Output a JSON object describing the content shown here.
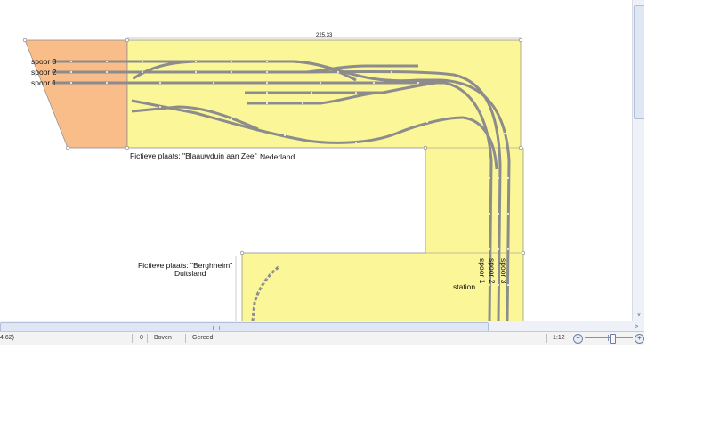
{
  "layout": {
    "upper_section": {
      "town_label": "Fictieve plaats: \"Blaauwduin aan Zee\"",
      "country": "Nederland",
      "tracks": [
        "spoor 3",
        "spoor 2",
        "spoor 1"
      ],
      "dimension": "225,33"
    },
    "lower_section": {
      "town_label_line1": "Fictieve plaats: \"Berghheim\"",
      "town_label_line2": "Duitsland",
      "station_label": "station",
      "station_tracks": [
        "spoor 1",
        "spoor 2",
        "spoor 3"
      ]
    },
    "colors": {
      "baseboard": "#fbf697",
      "baseboard_outline": "#8a8a8a",
      "corner_piece": "#f9bd8a",
      "track": "#8c8c8c"
    }
  },
  "statusbar": {
    "coords": "4.62)",
    "count": "0",
    "layer": "Boven",
    "status": "Gereed",
    "zoom": "1:12",
    "zoom_out": "−",
    "zoom_in": "+"
  },
  "scroll": {
    "down_arrow": "˅",
    "right_arrow": "˃"
  }
}
